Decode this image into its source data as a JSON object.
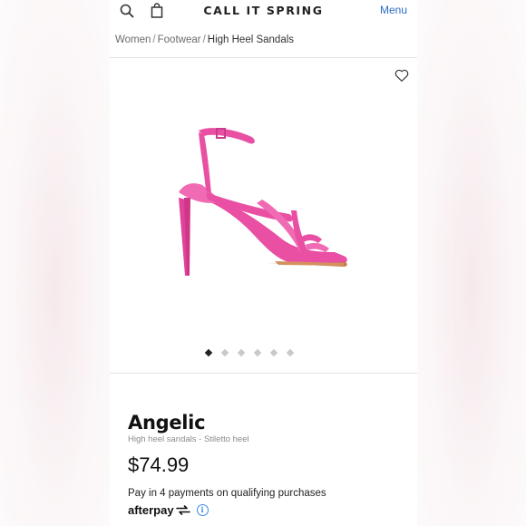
{
  "header": {
    "brand": "CALL IT SPRING",
    "menu_label": "Menu",
    "icons": [
      "search-icon",
      "shopping-bag-icon"
    ]
  },
  "breadcrumb": {
    "items": [
      "Women",
      "Footwear"
    ],
    "separator": "/",
    "current": "High Heel Sandals"
  },
  "gallery": {
    "slide_count": 6,
    "active_slide": 1,
    "wishlist_icon": "heart-outline-icon"
  },
  "product": {
    "name": "Angelic",
    "subtitle": "High heel sandals - Stiletto heel",
    "price": "$74.99",
    "installments_text": "Pay in 4 payments on qualifying purchases",
    "afterpay_label": "afterpay",
    "info_glyph": "i"
  },
  "colors": {
    "accent": "#2b6cc4",
    "shoe": "#e94fa3"
  }
}
